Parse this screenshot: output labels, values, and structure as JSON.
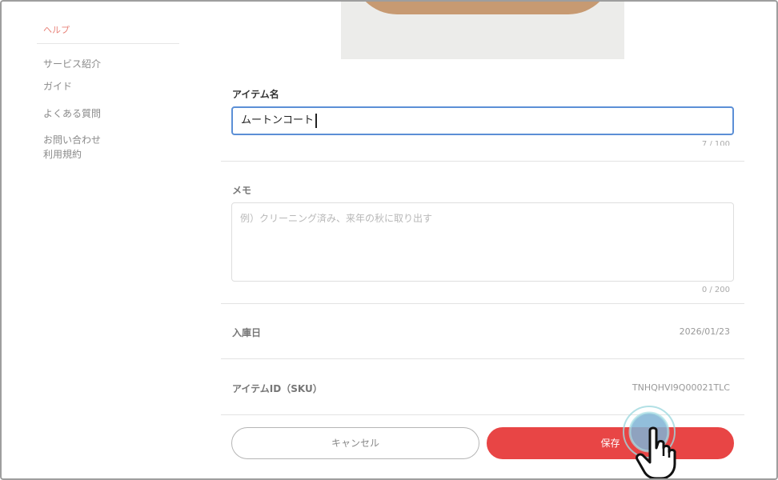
{
  "sidebar": {
    "heading": "ヘルプ",
    "links": [
      "サービス紹介",
      "ガイド",
      "よくある質問",
      "お問い合わせ",
      "利用規約"
    ]
  },
  "item_form": {
    "name_label": "アイテム名",
    "name_value": "ムートンコート",
    "memo_label": "メモ",
    "memo_placeholder": "例）クリーニング済み、来年の秋に取り出す",
    "memo_counter": "0 / 200",
    "arrival_label": "入庫日",
    "arrival_value": "2026/01/23",
    "sku_label": "アイテムID（SKU）",
    "sku_value": "TNHQHVI9Q00021TLC"
  },
  "actions": {
    "cancel_label": "キャンセル",
    "save_label": "保存"
  },
  "colors": {
    "accent": "#e84545",
    "focus": "#5b8fd6",
    "sidebar_heading": "#e8837a"
  },
  "icons": {
    "cursor": "hand-pointer-icon"
  }
}
